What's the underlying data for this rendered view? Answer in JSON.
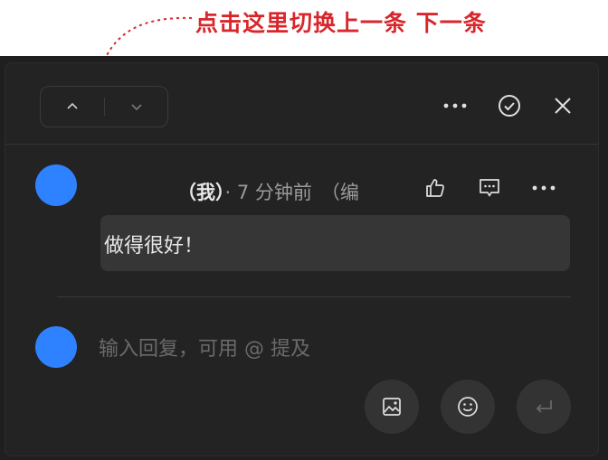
{
  "annotation": {
    "text": "点击这里切换上一条 下一条",
    "color": "#d9262b"
  },
  "comment": {
    "author_tag": "（我）",
    "time": "· 7 分钟前",
    "edited": "（编",
    "text": "做得很好！"
  },
  "reply": {
    "placeholder": "输入回复，可用 @ 提及"
  },
  "icons": {
    "up": "chevron-up-icon",
    "down": "chevron-down-icon",
    "more": "more-icon",
    "resolve": "check-circle-icon",
    "close": "close-icon",
    "like": "thumbs-up-icon",
    "reply": "comment-icon",
    "image": "image-icon",
    "emoji": "emoji-icon",
    "send": "enter-icon"
  },
  "colors": {
    "panel_bg": "#232323",
    "avatar": "#2f82ff",
    "bubble": "#363636"
  }
}
